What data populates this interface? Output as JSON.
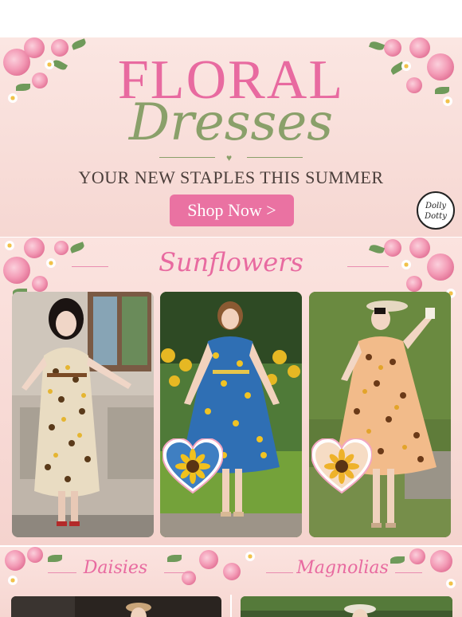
{
  "hero": {
    "title_line1": "FLORAL",
    "title_line2": "Dresses",
    "subtitle": "YOUR NEW STAPLES THIS SUMMER",
    "cta_label": "Shop Now >",
    "logo_text": "Dolly and Dotty"
  },
  "sunflowers": {
    "title": "Sunflowers",
    "products": [
      {
        "alt": "model in cream sunflower print dress"
      },
      {
        "alt": "model in blue sunflower print dress"
      },
      {
        "alt": "model in peach sunflower print dress with hat"
      }
    ]
  },
  "bottom": {
    "left_title": "Daisies",
    "right_title": "Magnolias"
  },
  "colors": {
    "accent_pink": "#e86aa0",
    "sage_green": "#8aa06a",
    "background_blush": "#f6d7d2",
    "button_pink": "#ea72a2"
  }
}
